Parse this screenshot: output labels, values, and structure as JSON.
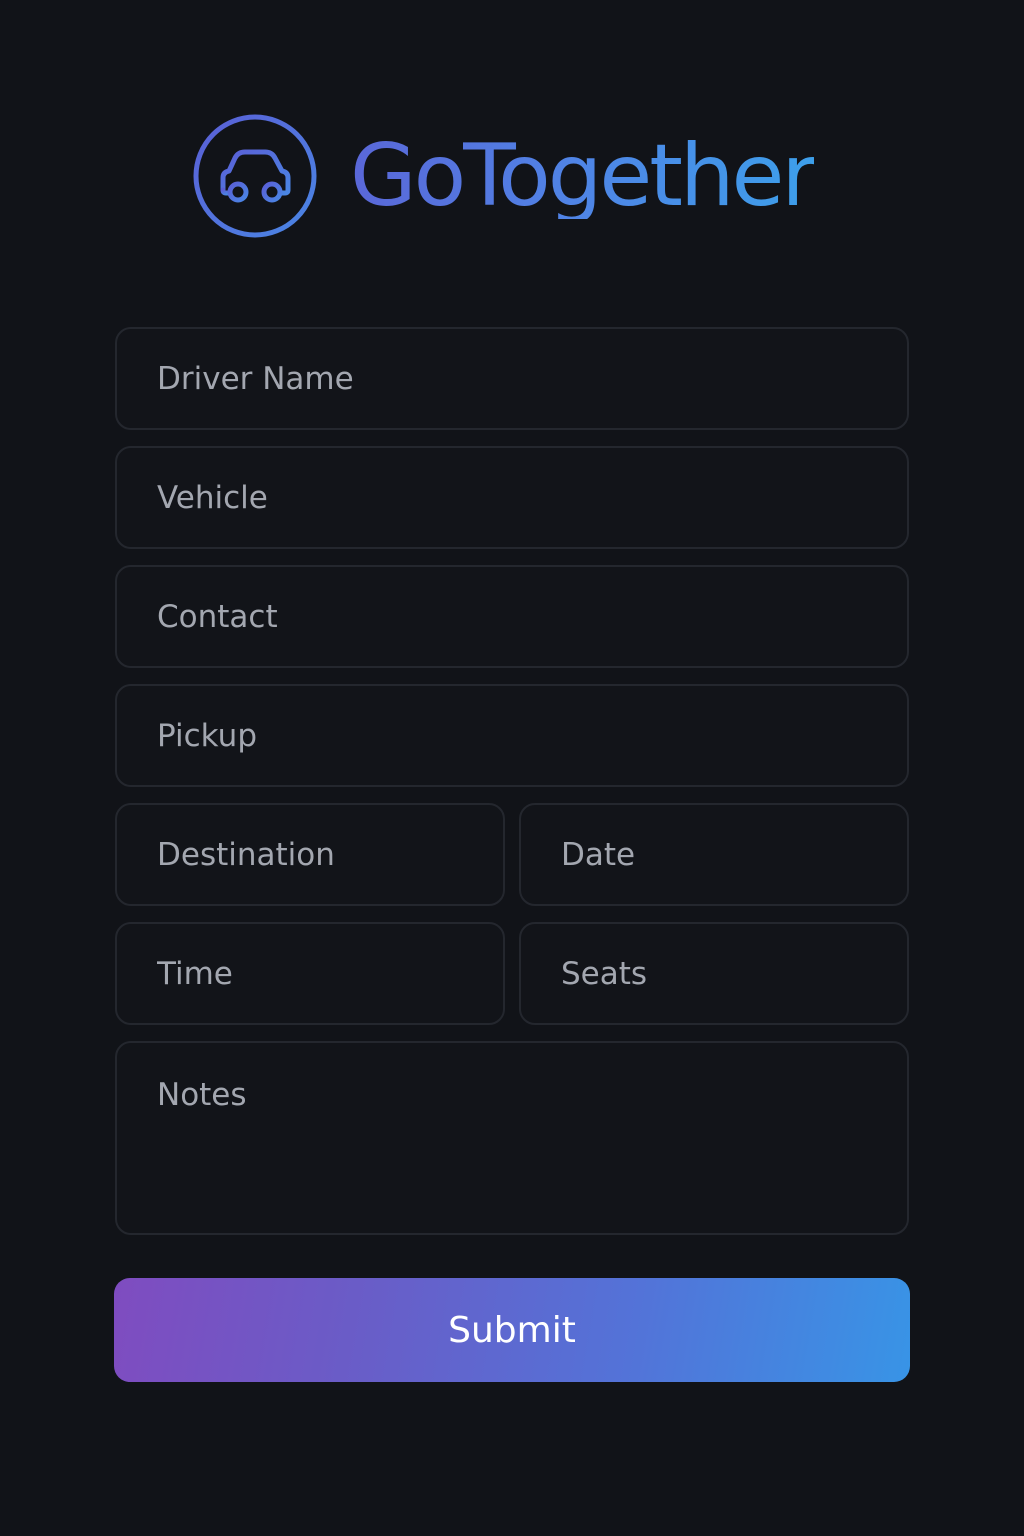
{
  "app": {
    "name": "GoTogether",
    "logo_icon": "car-in-circle-icon"
  },
  "form": {
    "driver_name": {
      "placeholder": "Driver Name",
      "value": ""
    },
    "vehicle": {
      "placeholder": "Vehicle",
      "value": ""
    },
    "contact": {
      "placeholder": "Contact",
      "value": ""
    },
    "pickup": {
      "placeholder": "Pickup",
      "value": ""
    },
    "destination": {
      "placeholder": "Destination",
      "value": ""
    },
    "date": {
      "placeholder": "Date",
      "value": ""
    },
    "time": {
      "placeholder": "Time",
      "value": ""
    },
    "seats": {
      "placeholder": "Seats",
      "value": ""
    },
    "notes": {
      "placeholder": "Notes",
      "value": ""
    }
  },
  "submit": {
    "label": "Submit"
  },
  "colors": {
    "background": "#111318",
    "field_background": "#121419",
    "field_border": "#24272e",
    "placeholder": "#a3a7b0",
    "brand_gradient_start": "#5a67d8",
    "brand_gradient_end": "#3d9fea",
    "button_gradient_start": "#7f4cc0",
    "button_gradient_end": "#3894e6"
  }
}
